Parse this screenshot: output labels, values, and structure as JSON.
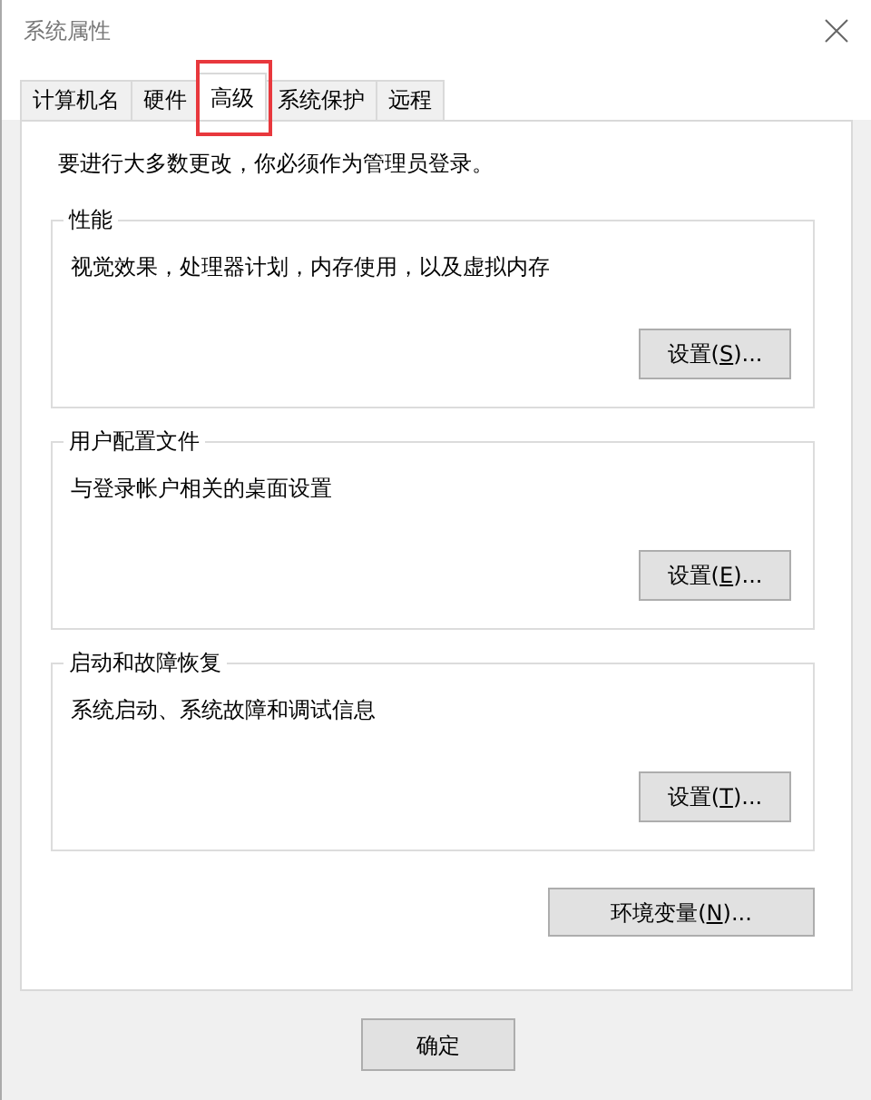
{
  "window": {
    "title": "系统属性"
  },
  "tabs": [
    {
      "label": "计算机名",
      "selected": false,
      "highlighted": false
    },
    {
      "label": "硬件",
      "selected": false,
      "highlighted": false
    },
    {
      "label": "高级",
      "selected": true,
      "highlighted": true
    },
    {
      "label": "系统保护",
      "selected": false,
      "highlighted": false
    },
    {
      "label": "远程",
      "selected": false,
      "highlighted": false
    }
  ],
  "notice": "要进行大多数更改，你必须作为管理员登录。",
  "groups": [
    {
      "title": "性能",
      "description": "视觉效果，处理器计划，内存使用，以及虚拟内存",
      "button": {
        "before": "设置(",
        "key": "S",
        "after": ")..."
      }
    },
    {
      "title": "用户配置文件",
      "description": "与登录帐户相关的桌面设置",
      "button": {
        "before": "设置(",
        "key": "E",
        "after": ")..."
      }
    },
    {
      "title": "启动和故障恢复",
      "description": "系统启动、系统故障和调试信息",
      "button": {
        "before": "设置(",
        "key": "T",
        "after": ")..."
      }
    }
  ],
  "env_button": {
    "before": "环境变量(",
    "key": "N",
    "after": ")..."
  },
  "footer_buttons": [
    "确定"
  ]
}
